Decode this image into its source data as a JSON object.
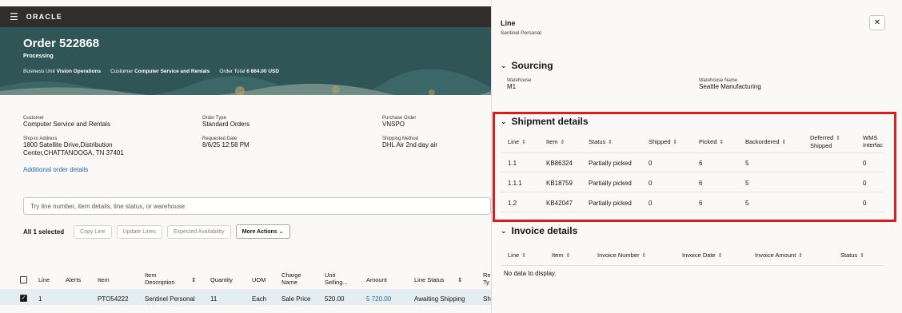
{
  "app": {
    "brand": "ORACLE",
    "menu_icon": "hamburger-icon"
  },
  "order": {
    "title": "Order 522868",
    "status": "Processing",
    "business_unit_label": "Business Unit",
    "business_unit": "Vision Operations",
    "customer_label": "Customer",
    "customer_header": "Computer Service and Rentals",
    "total_label": "Order Total",
    "total": "6 864.00 USD"
  },
  "details": {
    "customer_label": "Customer",
    "customer": "Computer Service and Rentals",
    "order_type_label": "Order Type",
    "order_type": "Standard Orders",
    "po_label": "Purchase Order",
    "po": "VNSPO",
    "ship_to_label": "Ship-to Address",
    "ship_to_1": "1800 Satellite Drive,Distribution",
    "ship_to_2": "Center,CHATTANOOGA, TN 37401",
    "req_date_label": "Requested Date",
    "req_date": "8/6/25 12:58 PM",
    "ship_method_label": "Shipping Method",
    "ship_method": "DHL Air 2nd day air",
    "additional_link": "Additional order details"
  },
  "search": {
    "placeholder": "Try line number, item details, line status, or warehouse"
  },
  "toolbar": {
    "selected": "All 1 selected",
    "copy_line": "Copy Line",
    "update_lines": "Update Lines",
    "expected_availability": "Expected Availability",
    "more_actions": "More Actions"
  },
  "lines_table": {
    "headers": {
      "line": "Line",
      "alerts": "Alerts",
      "item": "Item",
      "item_desc_1": "Item",
      "item_desc_2": "Description",
      "quantity": "Quantity",
      "uom": "UOM",
      "charge_1": "Charge",
      "charge_2": "Name",
      "unit_1": "Unit",
      "unit_2": "Selling...",
      "amount": "Amount",
      "line_status": "Line Status",
      "re_1": "Re",
      "re_2": "Ty"
    },
    "row": {
      "line": "1",
      "item": "PTO54222",
      "item_desc": "Sentinel Personal",
      "quantity": "11",
      "uom": "Each",
      "charge": "Sale Price",
      "unit": "520.00",
      "amount": "5 720.00",
      "status": "Awaiting Shipping",
      "re": "Sh"
    }
  },
  "drawer": {
    "title": "Line",
    "subtitle": "Sentinel Personal",
    "close_icon": "close-icon",
    "sourcing": {
      "title": "Sourcing",
      "warehouse_label": "Warehouse",
      "warehouse": "M1",
      "warehouse_name_label": "Warehouse Name",
      "warehouse_name": "Seattle Manufacturing"
    },
    "shipment": {
      "title": "Shipment details",
      "headers": {
        "line": "Line",
        "item": "Item",
        "status": "Status",
        "shipped": "Shipped",
        "picked": "Picked",
        "backordered": "Backordered",
        "deferred_1": "Deferred",
        "deferred_2": "Shipped",
        "wms_1": "WMS",
        "wms_2": "Interfac"
      },
      "rows": [
        {
          "line": "1.1",
          "item": "KB86324",
          "status": "Partially picked",
          "shipped": "0",
          "picked": "6",
          "backordered": "5",
          "wms": "0"
        },
        {
          "line": "1.1.1",
          "item": "KB18759",
          "status": "Partially picked",
          "shipped": "0",
          "picked": "6",
          "backordered": "5",
          "wms": "0"
        },
        {
          "line": "1.2",
          "item": "KB42047",
          "status": "Partially picked",
          "shipped": "0",
          "picked": "6",
          "backordered": "5",
          "wms": "0"
        }
      ]
    },
    "invoice": {
      "title": "Invoice details",
      "headers": {
        "line": "Line",
        "item": "Item",
        "number": "Invoice Number",
        "date": "Invoice Date",
        "amount": "Invoice Amount",
        "status": "Status"
      },
      "empty": "No data to display."
    }
  },
  "colors": {
    "hero": "#2f5557",
    "topbar": "#312d2a",
    "highlight": "#e01b1b",
    "link": "#2169a8"
  }
}
